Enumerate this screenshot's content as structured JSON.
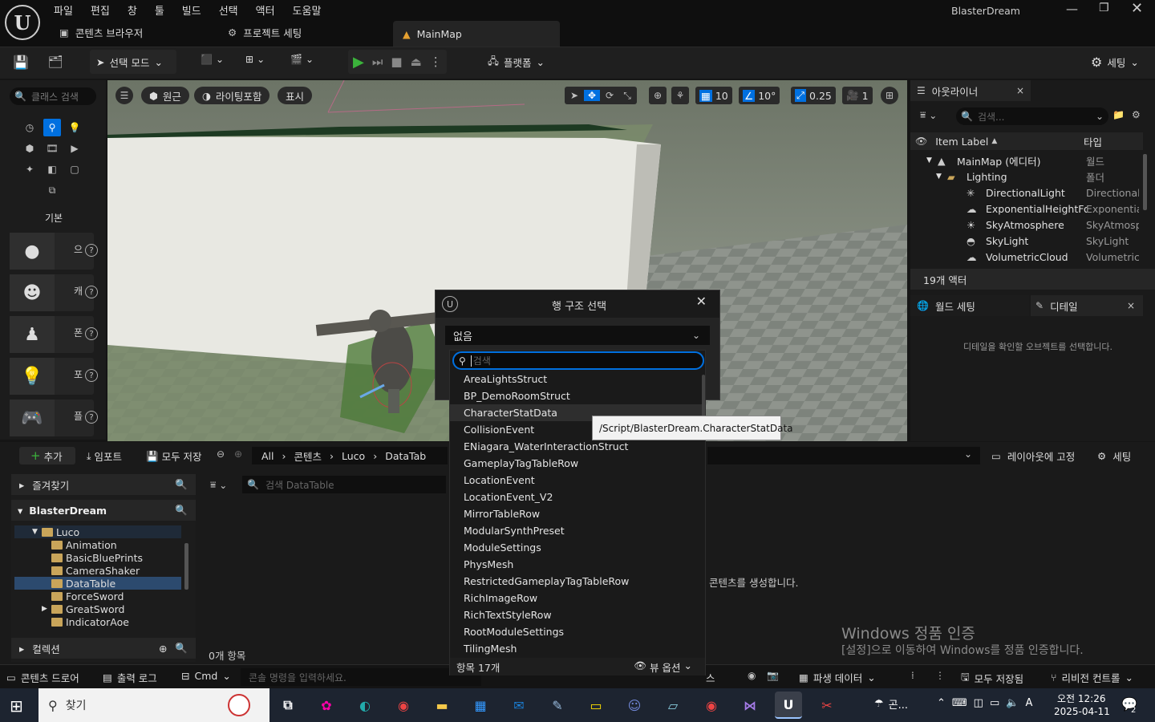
{
  "app": {
    "project_name": "BlasterDream"
  },
  "menu": [
    "파일",
    "편집",
    "창",
    "툴",
    "빌드",
    "선택",
    "액터",
    "도움말"
  ],
  "tabs": {
    "content_browser": "콘텐츠 브라우저",
    "project_settings": "프로젝트 세팅",
    "main_map": "MainMap"
  },
  "toolbar": {
    "select_mode": "선택 모드",
    "platform": "플랫폼",
    "settings": "세팅"
  },
  "left_panel": {
    "search_placeholder": "클래스 검색",
    "basic_label": "기본",
    "items": [
      {
        "text": "으"
      },
      {
        "text": "캐"
      },
      {
        "text": "폰"
      },
      {
        "text": "포"
      },
      {
        "text": "플"
      }
    ]
  },
  "viewport": {
    "perspective": "원근",
    "lighting": "라이팅포함",
    "show": "표시",
    "grid_snap": "10",
    "rot_snap": "10°",
    "scale_snap": "0.25",
    "camera_speed": "1"
  },
  "outliner": {
    "title": "아웃라이너",
    "search_placeholder": "검색...",
    "col_label": "Item Label",
    "col_type": "타입",
    "rows": [
      {
        "label": "MainMap (에디터)",
        "type": "월드"
      },
      {
        "label": "Lighting",
        "type": "폴더"
      },
      {
        "label": "DirectionalLight",
        "type": "DirectionalL"
      },
      {
        "label": "ExponentialHeightFo",
        "type": "Exponential"
      },
      {
        "label": "SkyAtmosphere",
        "type": "SkyAtmosp"
      },
      {
        "label": "SkyLight",
        "type": "SkyLight"
      },
      {
        "label": "VolumetricCloud",
        "type": "Volumetric("
      }
    ],
    "count": "19개 액터"
  },
  "details": {
    "world_settings": "월드 세팅",
    "title": "디테일",
    "empty_msg": "디테일을 확인할 오브젝트를 선택합니다."
  },
  "content_browser": {
    "add": "추가",
    "import": "임포트",
    "save_all": "모두 저장",
    "breadcrumb": [
      "All",
      "콘텐츠",
      "Luco",
      "DataTab"
    ],
    "lock_layout": "레이아웃에 고정",
    "settings": "세팅",
    "favorites": "즐겨찾기",
    "project": "BlasterDream",
    "tree": [
      {
        "name": "Luco",
        "depth": 1,
        "open": true
      },
      {
        "name": "Animation",
        "depth": 2
      },
      {
        "name": "BasicBluePrints",
        "depth": 2
      },
      {
        "name": "CameraShaker",
        "depth": 2
      },
      {
        "name": "DataTable",
        "depth": 2,
        "selected": true
      },
      {
        "name": "ForceSword",
        "depth": 2
      },
      {
        "name": "GreatSword",
        "depth": 2,
        "arrow": true
      },
      {
        "name": "IndicatorAoe",
        "depth": 2
      }
    ],
    "collections": "컬렉션",
    "search_placeholder": "검색 DataTable",
    "item_count": "0개 항목",
    "create_msg": "콘텐츠를 생성합니다.",
    "watermark_title": "Windows 정품 인증",
    "watermark_sub": "[설정]으로 이동하여 Windows를 정품 인증합니다."
  },
  "dialog": {
    "title": "행 구조 선택",
    "selected": "없음",
    "search_placeholder": "검색",
    "options": [
      "AreaLightsStruct",
      "BP_DemoRoomStruct",
      "CharacterStatData",
      "CollisionEvent",
      "ENiagara_WaterInteractionStruct",
      "GameplayTagTableRow",
      "LocationEvent",
      "LocationEvent_V2",
      "MirrorTableRow",
      "ModularSynthPreset",
      "ModuleSettings",
      "PhysMesh",
      "RestrictedGameplayTagTableRow",
      "RichImageRow",
      "RichTextStyleRow",
      "RootModuleSettings",
      "TilingMesh"
    ],
    "hover_index": 2,
    "item_count": "항목 17개",
    "view_options": "뷰 옵션",
    "tooltip": "/Script/BlasterDream.CharacterStatData"
  },
  "statusbar": {
    "content_drawer": "콘텐츠 드로어",
    "output_log": "출력 로그",
    "cmd": "Cmd",
    "console_placeholder": "콘솔 명령을 입력하세요.",
    "trace_partial": "스",
    "derived_data": "파생 데이터",
    "save_all": "모두 저장됨",
    "revision": "리비전 컨트롤"
  },
  "taskbar": {
    "search": "찾기",
    "weather": "곤...",
    "ime": "A",
    "time": "오전 12:26",
    "date": "2025-04-11",
    "notif_count": "2"
  },
  "colors": {
    "accent": "#0070e0",
    "play": "#3bb33b",
    "selected": "#2c4a6e"
  }
}
